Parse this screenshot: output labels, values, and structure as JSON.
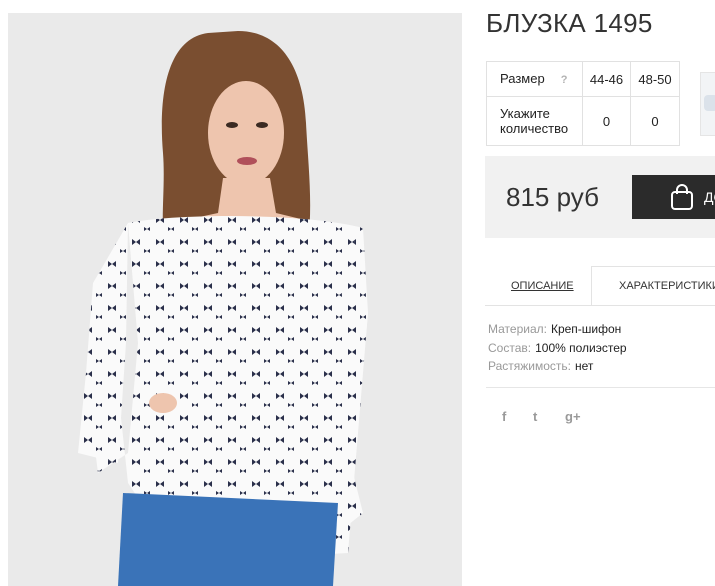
{
  "product": {
    "title": "БЛУЗКА 1495",
    "price": "815 руб",
    "buy_label": "ДО"
  },
  "sizes": {
    "size_label": "Размер",
    "help": "?",
    "columns": [
      "44-46",
      "48-50"
    ],
    "qty_label_line1": "Укажите",
    "qty_label_line2": "количество",
    "quantities": [
      "0",
      "0"
    ]
  },
  "tabs": [
    {
      "label": "Описание"
    },
    {
      "label": "Характеристики"
    }
  ],
  "specs": [
    {
      "key": "Материал:",
      "value": "Креп-шифон"
    },
    {
      "key": "Состав:",
      "value": "100% полиэстер"
    },
    {
      "key": "Растяжимость:",
      "value": "нет"
    }
  ],
  "social": {
    "facebook": "f",
    "twitter": "t",
    "google": "g+"
  },
  "icons": [
    "bag-icon",
    "facebook-icon",
    "twitter-icon",
    "google-plus-icon",
    "help-icon"
  ]
}
